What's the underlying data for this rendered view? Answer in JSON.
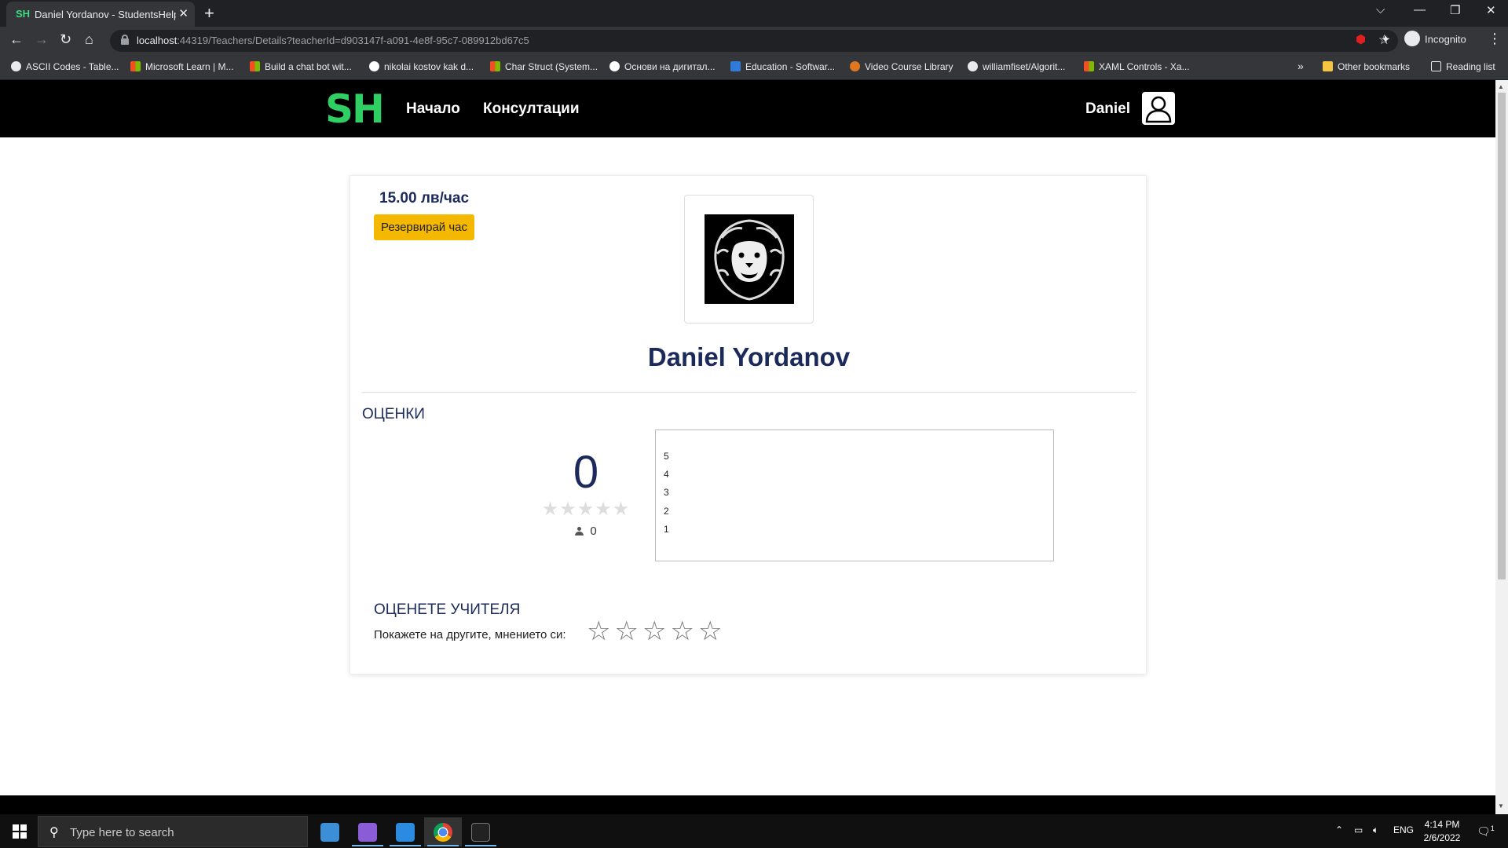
{
  "browser": {
    "tab_favicon": "SH",
    "tab_title": "Daniel Yordanov - StudentsHelper",
    "url_host": "localhost",
    "url_rest": ":44319/Teachers/Details?teacherId=d903147f-a091-4e8f-95c7-089912bd67c5",
    "incognito_label": "Incognito",
    "bookmarks": [
      {
        "label": "ASCII Codes - Table...",
        "icon": "globe"
      },
      {
        "label": "Microsoft Learn | M...",
        "icon": "microsoft"
      },
      {
        "label": "Build a chat bot wit...",
        "icon": "microsoft"
      },
      {
        "label": "nikolai kostov kak d...",
        "icon": "google"
      },
      {
        "label": "Char Struct (System...",
        "icon": "microsoft"
      },
      {
        "label": "Основи на дигитал...",
        "icon": "google"
      },
      {
        "label": "Education - Softwar...",
        "icon": "azure"
      },
      {
        "label": "Video Course Library",
        "icon": "youtube"
      },
      {
        "label": "williamfiset/Algorit...",
        "icon": "github"
      },
      {
        "label": "XAML Controls - Xa...",
        "icon": "microsoft"
      }
    ],
    "more_bookmarks": "»",
    "other_bookmarks": "Other bookmarks",
    "reading_list": "Reading list"
  },
  "site": {
    "logo": "SH",
    "nav": {
      "home": "Начало",
      "consultations": "Консултации"
    },
    "user_name": "Daniel"
  },
  "teacher": {
    "price": "15.00 лв/час",
    "reserve_label": "Резервирай час",
    "name": "Daniel Yordanov"
  },
  "ratings": {
    "title": "ОЦЕНКИ",
    "average": "0",
    "average_stars": 0,
    "votes": "0",
    "distribution_labels": [
      "5",
      "4",
      "3",
      "2",
      "1"
    ]
  },
  "rate": {
    "title": "ОЦЕНЕТЕ УЧИТЕЛЯ",
    "prompt": "Покажете на другите, мнението си:",
    "star_count": 5
  },
  "taskbar": {
    "search_placeholder": "Type here to search",
    "language": "ENG",
    "time": "4:14 PM",
    "date": "2/6/2022",
    "notification_count": "1"
  }
}
